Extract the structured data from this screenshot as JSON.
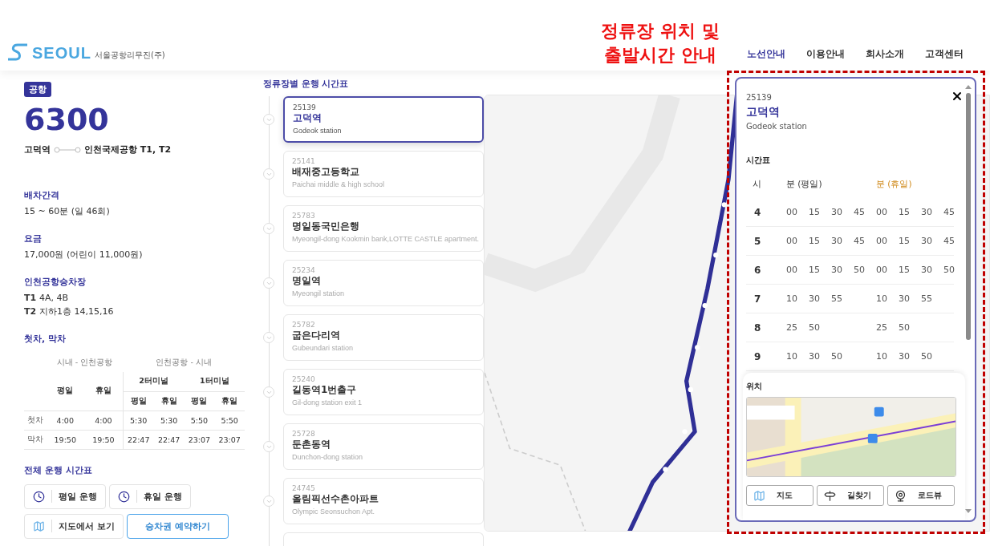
{
  "header": {
    "logo": {
      "wordmark": "SEOUL",
      "company": "서울공항리무진(주)"
    },
    "annotation": [
      "정류장 위치 및",
      "출발시간 안내"
    ],
    "nav": [
      {
        "label": "노선안내",
        "selected": true
      },
      {
        "label": "이용안내",
        "selected": false
      },
      {
        "label": "회사소개",
        "selected": false
      },
      {
        "label": "고객센터",
        "selected": false
      }
    ]
  },
  "route": {
    "badge": "공항",
    "number": "6300",
    "from": "고덕역",
    "to": "인천국제공항 T1, T2",
    "info": [
      {
        "title": "배차간격",
        "lines": [
          {
            "text": "15 ~ 60분 (일 46회)"
          }
        ]
      },
      {
        "title": "요금",
        "lines": [
          {
            "text": "17,000원 (어린이 11,000원)"
          }
        ]
      },
      {
        "title": "인천공항승차장",
        "lines": [
          {
            "bold": "T1",
            "text": "4A, 4B"
          },
          {
            "bold": "T2",
            "text": "지하1층 14,15,16"
          }
        ]
      }
    ],
    "first_last": {
      "title": "첫차, 막차",
      "group_a": "시내 - 인천공항",
      "group_b": "인천공항 - 시내",
      "terminals": [
        "2터미널",
        "1터미널"
      ],
      "a_subheaders": [
        "평일",
        "휴일"
      ],
      "b_subheaders": [
        "평일",
        "휴일",
        "평일",
        "휴일"
      ],
      "rows": [
        {
          "label": "첫차",
          "values": [
            "4:00",
            "4:00",
            "5:30",
            "5:30",
            "5:50",
            "5:50"
          ]
        },
        {
          "label": "막차",
          "values": [
            "19:50",
            "19:50",
            "22:47",
            "22:47",
            "23:07",
            "23:07"
          ]
        }
      ]
    },
    "full_timetable": {
      "title": "전체 운행 시간표",
      "buttons": [
        {
          "kind": "clock",
          "label": "평일 운행"
        },
        {
          "kind": "clock",
          "label": "휴일 운행"
        },
        {
          "kind": "map",
          "label": "지도에서 보기"
        },
        {
          "kind": "reserve",
          "label": "승차권 예약하기"
        }
      ]
    }
  },
  "stops": {
    "title": "정류장별 운행 시간표",
    "items": [
      {
        "code": "25139",
        "name": "고덕역",
        "english": "Godeok station",
        "selected": true
      },
      {
        "code": "25141",
        "name": "배재중고등학교",
        "english": "Paichai middle & high school",
        "selected": false
      },
      {
        "code": "25783",
        "name": "명일동국민은행",
        "english": "Myeongil-dong Kookmin bank,LOTTE CASTLE apartment.",
        "selected": false
      },
      {
        "code": "25234",
        "name": "명일역",
        "english": "Myeongil station",
        "selected": false
      },
      {
        "code": "25782",
        "name": "굽은다리역",
        "english": "Gubeundari station",
        "selected": false
      },
      {
        "code": "25240",
        "name": "길동역1번출구",
        "english": "Gil-dong station exit 1",
        "selected": false
      },
      {
        "code": "25728",
        "name": "둔촌동역",
        "english": "Dunchon-dong station",
        "selected": false
      },
      {
        "code": "24745",
        "name": "올림픽선수촌아파트",
        "english": "Olympic Seonsuchon Apt.",
        "selected": false
      }
    ]
  },
  "stop_detail": {
    "code": "25139",
    "name": "고덕역",
    "english": "Godeok station",
    "timetable_title": "시간표",
    "columns": [
      "시",
      "분 (평일)",
      "분 (휴일)"
    ],
    "rows": [
      {
        "hour": "4",
        "weekday": [
          "00",
          "15",
          "30",
          "45"
        ],
        "holiday": [
          "00",
          "15",
          "30",
          "45"
        ]
      },
      {
        "hour": "5",
        "weekday": [
          "00",
          "15",
          "30",
          "45"
        ],
        "holiday": [
          "00",
          "15",
          "30",
          "45"
        ]
      },
      {
        "hour": "6",
        "weekday": [
          "00",
          "15",
          "30",
          "50"
        ],
        "holiday": [
          "00",
          "15",
          "30",
          "50"
        ]
      },
      {
        "hour": "7",
        "weekday": [
          "10",
          "30",
          "55"
        ],
        "holiday": [
          "10",
          "30",
          "55"
        ]
      },
      {
        "hour": "8",
        "weekday": [
          "25",
          "50"
        ],
        "holiday": [
          "25",
          "50"
        ]
      },
      {
        "hour": "9",
        "weekday": [
          "10",
          "30",
          "50"
        ],
        "holiday": [
          "10",
          "30",
          "50"
        ]
      }
    ],
    "location_title": "위치",
    "buttons": [
      {
        "kind": "map",
        "label": "지도"
      },
      {
        "kind": "directions",
        "label": "길찾기"
      },
      {
        "kind": "roadview",
        "label": "로드뷰"
      }
    ]
  }
}
